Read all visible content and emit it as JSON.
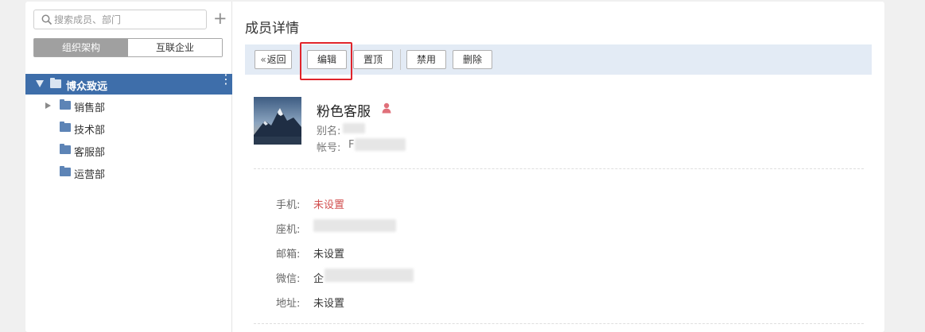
{
  "search": {
    "placeholder": "搜索成员、部门"
  },
  "segments": {
    "org": "组织架构",
    "ext": "互联企业"
  },
  "tree": {
    "root": "博众致远",
    "children": [
      {
        "label": "销售部",
        "expandable": true
      },
      {
        "label": "技术部",
        "expandable": false
      },
      {
        "label": "客服部",
        "expandable": false
      },
      {
        "label": "运营部",
        "expandable": false
      }
    ]
  },
  "page": {
    "title": "成员详情"
  },
  "toolbar": {
    "back_label": "返回",
    "edit_label": "编辑",
    "top_label": "置顶",
    "disable_label": "禁用",
    "delete_label": "删除"
  },
  "member": {
    "name": "粉色客服",
    "alias_label": "别名:",
    "account_label": "帐号:",
    "account_prefix": "F"
  },
  "info": {
    "mobile_label": "手机:",
    "mobile_value": "未设置",
    "landline_label": "座机:",
    "email_label": "邮箱:",
    "email_value": "未设置",
    "wechat_label": "微信:",
    "wechat_prefix": "企",
    "address_label": "地址:",
    "address_value": "未设置"
  },
  "colors": {
    "accent": "#3e6eaa",
    "toolbar_bg": "#e3ebf5",
    "highlight": "#e0242b",
    "unset_red": "#d24f4f"
  }
}
